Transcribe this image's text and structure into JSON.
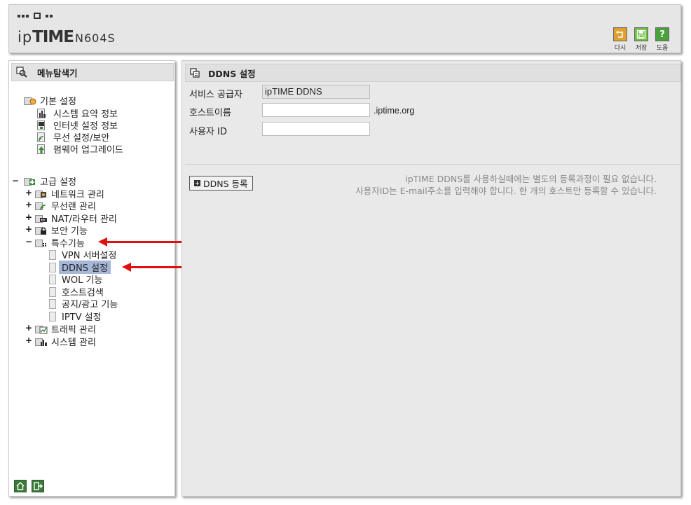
{
  "header": {
    "logo_ip": "ip",
    "logo_time": "TIME",
    "logo_model": "N604S",
    "buttons": [
      {
        "label": "다시",
        "icon": "undo-icon",
        "color": "#e0a030"
      },
      {
        "label": "저장",
        "icon": "save-icon",
        "color": "#6cbf3f"
      },
      {
        "label": "도움",
        "icon": "help-icon",
        "color": "#4aa03a"
      }
    ],
    "help_glyph": "?"
  },
  "sidebar": {
    "title": "메뉴탐색기",
    "basic": {
      "label": "기본 설정",
      "items": [
        "시스템 요약 정보",
        "인터넷 설정 정보",
        "무선 설정/보안",
        "펌웨어 업그레이드"
      ]
    },
    "advanced": {
      "label": "고급 설정",
      "toggle": "−",
      "items": [
        {
          "label": "네트워크 관리",
          "toggle": "+"
        },
        {
          "label": "무선랜 관리",
          "toggle": "+"
        },
        {
          "label": "NAT/라우터 관리",
          "toggle": "+"
        },
        {
          "label": "보안 기능",
          "toggle": "+"
        },
        {
          "label": "특수기능",
          "toggle": "−"
        }
      ],
      "special_children": [
        "VPN 서버설정",
        "DDNS 설정",
        "WOL 기능",
        "호스트검색",
        "공지/광고 기능",
        "IPTV 설정"
      ],
      "after": [
        {
          "label": "트래픽 관리",
          "toggle": "+"
        },
        {
          "label": "시스템 관리",
          "toggle": "+"
        }
      ]
    },
    "selected": "DDNS 설정"
  },
  "main": {
    "title": "DDNS 설정",
    "fields": {
      "provider_label": "서비스 공급자",
      "provider_value": "ipTIME DDNS",
      "hostname_label": "호스트이름",
      "hostname_value": "",
      "hostname_suffix": ".iptime.org",
      "userid_label": "사용자 ID",
      "userid_value": ""
    },
    "register_button": "DDNS 등록",
    "note_line1": "ipTIME DDNS를 사용하실때에는 별도의 등록과정이 필요 없습니다.",
    "note_line2": "사용자ID는 E-mail주소를 입력해야 합니다. 한 개의 호스트만 등록할 수 있습니다."
  },
  "colors": {
    "arrow": "#e01010",
    "selected_bg": "#a6b7d9"
  }
}
